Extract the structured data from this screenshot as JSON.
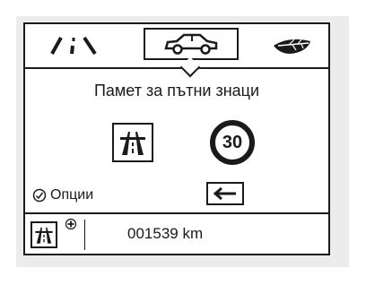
{
  "tabs": [
    {
      "name": "road-tab",
      "icon": "road-lanes-icon"
    },
    {
      "name": "car-tab",
      "icon": "car-icon",
      "selected": true
    },
    {
      "name": "eco-tab",
      "icon": "leaf-icon"
    }
  ],
  "main": {
    "title": "Памет за пътни знаци",
    "speed_limit": "30",
    "sign_icon": "motorway-sign-icon"
  },
  "options": {
    "label": "Опции",
    "icon": "check-circle-icon"
  },
  "back": {
    "icon": "arrow-left-icon"
  },
  "status_bar": {
    "odometer": "001539 km",
    "sign_icon": "motorway-sign-icon",
    "plus_icon": "plus-icon"
  }
}
